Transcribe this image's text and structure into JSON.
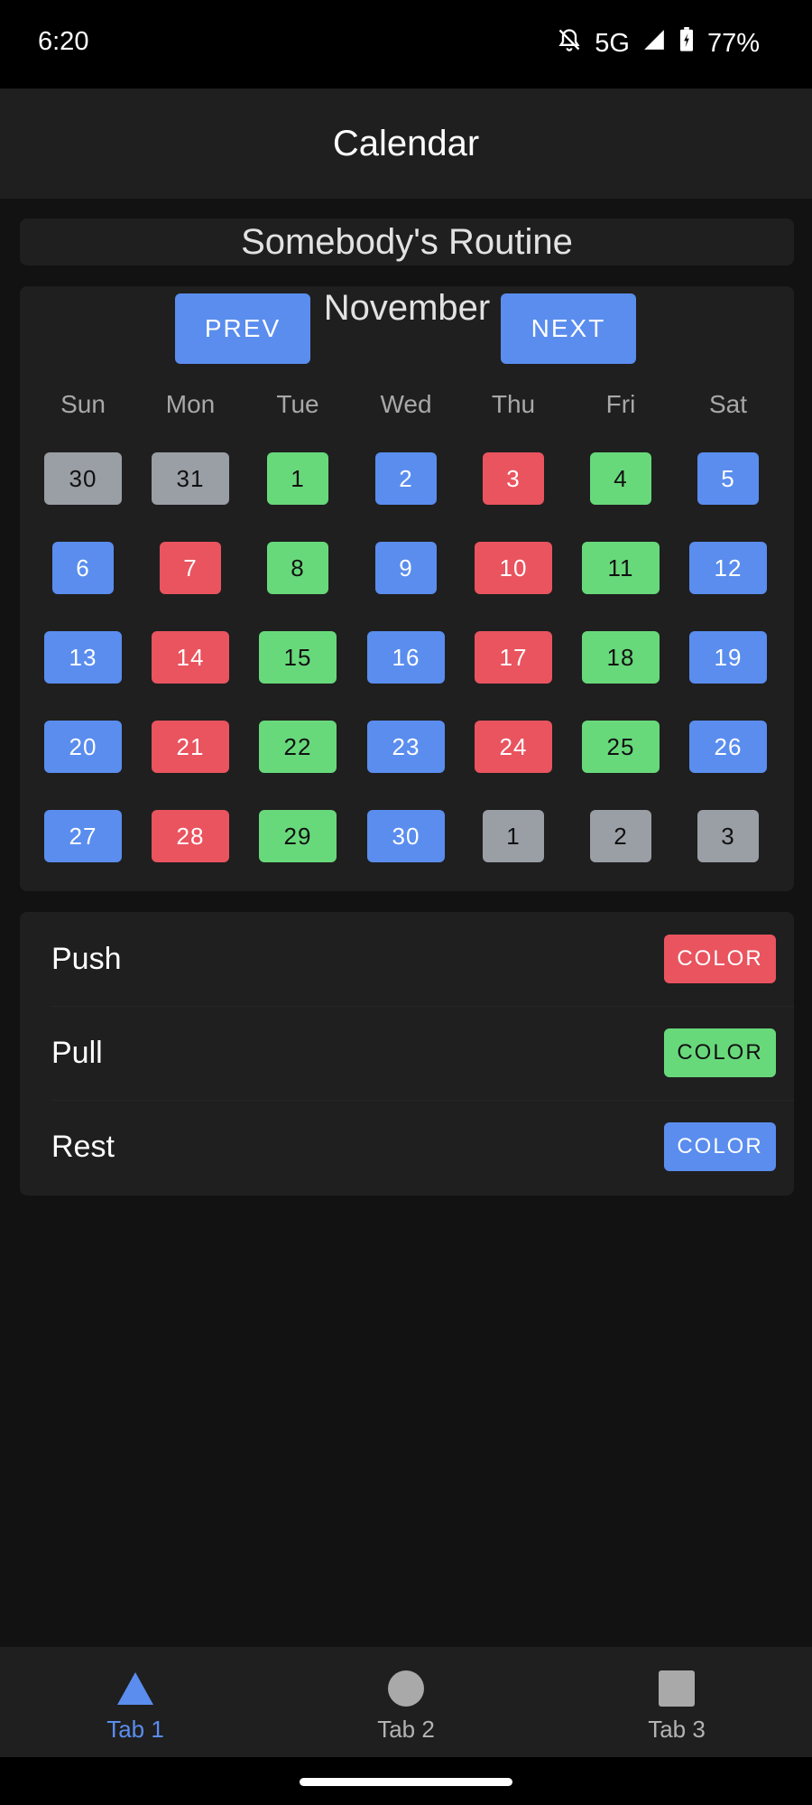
{
  "status_bar": {
    "time": "6:20",
    "network": "5G",
    "battery": "77%"
  },
  "app_bar": {
    "title": "Calendar"
  },
  "routine": {
    "title": "Somebody's Routine"
  },
  "calendar": {
    "month": "November",
    "prev_label": "PREV",
    "next_label": "NEXT",
    "weekdays": [
      "Sun",
      "Mon",
      "Tue",
      "Wed",
      "Thu",
      "Fri",
      "Sat"
    ],
    "weeks": [
      [
        {
          "d": "30",
          "t": "out"
        },
        {
          "d": "31",
          "t": "out"
        },
        {
          "d": "1",
          "t": "pull"
        },
        {
          "d": "2",
          "t": "rest"
        },
        {
          "d": "3",
          "t": "push"
        },
        {
          "d": "4",
          "t": "pull"
        },
        {
          "d": "5",
          "t": "rest"
        }
      ],
      [
        {
          "d": "6",
          "t": "rest"
        },
        {
          "d": "7",
          "t": "push"
        },
        {
          "d": "8",
          "t": "pull"
        },
        {
          "d": "9",
          "t": "rest"
        },
        {
          "d": "10",
          "t": "push"
        },
        {
          "d": "11",
          "t": "pull"
        },
        {
          "d": "12",
          "t": "rest"
        }
      ],
      [
        {
          "d": "13",
          "t": "rest"
        },
        {
          "d": "14",
          "t": "push"
        },
        {
          "d": "15",
          "t": "pull"
        },
        {
          "d": "16",
          "t": "rest"
        },
        {
          "d": "17",
          "t": "push"
        },
        {
          "d": "18",
          "t": "pull"
        },
        {
          "d": "19",
          "t": "rest"
        }
      ],
      [
        {
          "d": "20",
          "t": "rest"
        },
        {
          "d": "21",
          "t": "push"
        },
        {
          "d": "22",
          "t": "pull"
        },
        {
          "d": "23",
          "t": "rest"
        },
        {
          "d": "24",
          "t": "push"
        },
        {
          "d": "25",
          "t": "pull"
        },
        {
          "d": "26",
          "t": "rest"
        }
      ],
      [
        {
          "d": "27",
          "t": "rest"
        },
        {
          "d": "28",
          "t": "push"
        },
        {
          "d": "29",
          "t": "pull"
        },
        {
          "d": "30",
          "t": "rest"
        },
        {
          "d": "1",
          "t": "out"
        },
        {
          "d": "2",
          "t": "out"
        },
        {
          "d": "3",
          "t": "out"
        }
      ]
    ]
  },
  "legend": [
    {
      "label": "Push",
      "button": "COLOR",
      "type": "push"
    },
    {
      "label": "Pull",
      "button": "COLOR",
      "type": "pull"
    },
    {
      "label": "Rest",
      "button": "COLOR",
      "type": "rest"
    }
  ],
  "colors": {
    "push": "#e9545f",
    "pull": "#68d97b",
    "rest": "#5a8dee",
    "out": "#9a9ea5",
    "accent": "#5a8dee"
  },
  "bottom_nav": {
    "tabs": [
      {
        "label": "Tab 1",
        "icon": "triangle-icon",
        "active": true
      },
      {
        "label": "Tab 2",
        "icon": "circle-icon",
        "active": false
      },
      {
        "label": "Tab 3",
        "icon": "square-icon",
        "active": false
      }
    ]
  }
}
